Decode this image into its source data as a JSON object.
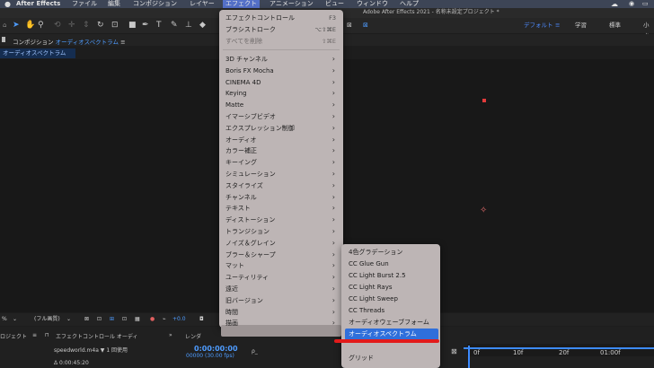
{
  "menubar": {
    "app": "After Effects",
    "items": [
      "ファイル",
      "編集",
      "コンポジション",
      "レイヤー",
      "エフェクト",
      "アニメーション",
      "ビュー",
      "ウィンドウ",
      "ヘルプ"
    ]
  },
  "window_title": "Adobe After Effects 2021 - 名称未設定プロジェクト *",
  "workspaces": [
    "デフォルト",
    "学習",
    "標準",
    "小さ"
  ],
  "workspace_menu_icon": "≡",
  "composition_panel": {
    "label": "コンポジション",
    "name": "オーディオスペクトラム",
    "menu_icon": "≡",
    "subtab": "オーディオスペクトラム"
  },
  "viewer_controls": {
    "zoom": "%",
    "resolution": "(フル画質)",
    "value": "+0.0"
  },
  "project_panel": {
    "tab": "ロジェクト",
    "menu_icon": "≡",
    "effect_controls_tab": "エフェクトコントロール オーディ",
    "file_info": "speedworld.m4a ▼ 1 回使用",
    "duration": "Δ 0:00:45:20"
  },
  "render_tab": "レンダ",
  "timeline": {
    "timecode": "0:00:00:00",
    "fps": "00000 (30.00 fps)",
    "search_placeholder": "ρ_",
    "ticks": [
      "0f",
      "10f",
      "20f",
      "01:00f"
    ]
  },
  "effect_menu": {
    "items": [
      {
        "label": "エフェクトコントロール",
        "shortcut": "F3",
        "disabled": false
      },
      {
        "label": "ブラシストローク",
        "shortcut": "⌥⇧⌘E",
        "disabled": false
      },
      {
        "label": "すべてを削除",
        "shortcut": "⇧⌘E",
        "disabled": true
      },
      {
        "label": "3D チャンネル",
        "submenu": true
      },
      {
        "label": "Boris FX Mocha",
        "submenu": true
      },
      {
        "label": "CINEMA 4D",
        "submenu": true
      },
      {
        "label": "Keying",
        "submenu": true
      },
      {
        "label": "Matte",
        "submenu": true
      },
      {
        "label": "イマーシブビデオ",
        "submenu": true
      },
      {
        "label": "エクスプレッション制御",
        "submenu": true
      },
      {
        "label": "オーディオ",
        "submenu": true
      },
      {
        "label": "カラー補正",
        "submenu": true
      },
      {
        "label": "キーイング",
        "submenu": true
      },
      {
        "label": "シミュレーション",
        "submenu": true
      },
      {
        "label": "スタイライズ",
        "submenu": true
      },
      {
        "label": "チャンネル",
        "submenu": true
      },
      {
        "label": "テキスト",
        "submenu": true
      },
      {
        "label": "ディストーション",
        "submenu": true
      },
      {
        "label": "トランジション",
        "submenu": true
      },
      {
        "label": "ノイズ＆グレイン",
        "submenu": true
      },
      {
        "label": "ブラー＆シャープ",
        "submenu": true
      },
      {
        "label": "マット",
        "submenu": true
      },
      {
        "label": "ユーティリティ",
        "submenu": true
      },
      {
        "label": "遠近",
        "submenu": true
      },
      {
        "label": "旧バージョン",
        "submenu": true
      },
      {
        "label": "時間",
        "submenu": true
      },
      {
        "label": "描画",
        "submenu": true,
        "highlighted": true
      }
    ],
    "arrow": "›"
  },
  "draw_submenu": {
    "items": [
      "4色グラデーション",
      "CC Glue Gun",
      "CC Light Burst 2.5",
      "CC Light Rays",
      "CC Light Sweep",
      "CC Threads",
      "オーディオウェーブフォーム",
      "オーディオスペクトラム",
      "グリッド"
    ],
    "selected_index": 7
  },
  "colors": {
    "accent": "#3d8bff",
    "highlight": "#2f6fdb",
    "annotation": "#e21b1b",
    "menu_bg": "#bdb5b5"
  }
}
